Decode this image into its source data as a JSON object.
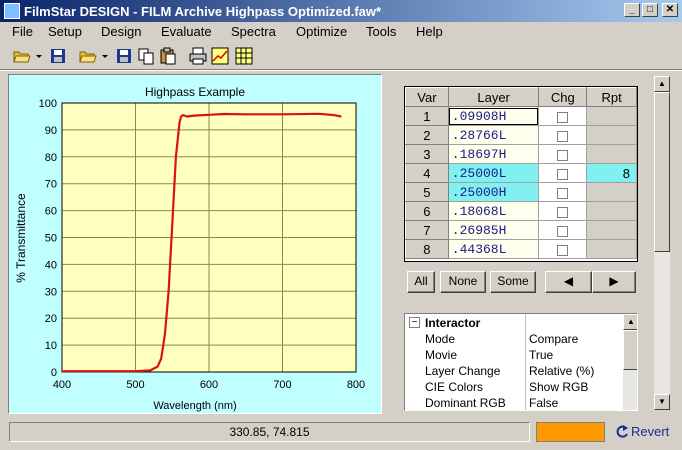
{
  "window": {
    "title": "FilmStar DESIGN - FILM Archive Highpass Optimized.faw*",
    "controls": [
      "_",
      "□",
      "✕"
    ]
  },
  "menu": [
    "File",
    "Setup",
    "Design",
    "Evaluate",
    "Spectra",
    "Optimize",
    "Tools",
    "Help"
  ],
  "toolbar": [
    "open-icon",
    "save-icon",
    "open-icon",
    "save-icon",
    "copy-icon",
    "paste-icon",
    "print-icon",
    "chart-icon",
    "table-icon"
  ],
  "chart_data": {
    "type": "line",
    "title": "Highpass Example",
    "xlabel": "Wavelength (nm)",
    "ylabel": "% Transmittance",
    "xlim": [
      400,
      800
    ],
    "ylim": [
      0,
      100
    ],
    "xticks": [
      "400",
      "500",
      "600",
      "700",
      "800"
    ],
    "yticks": [
      "0",
      "10",
      "20",
      "30",
      "40",
      "50",
      "60",
      "70",
      "80",
      "90",
      "100"
    ],
    "grid": true,
    "series": [
      {
        "color": "#dd1111",
        "x": [
          400,
          500,
          520,
          530,
          535,
          540,
          545,
          550,
          555,
          560,
          562,
          565,
          570,
          580,
          600,
          620,
          650,
          700,
          750,
          770,
          780
        ],
        "y": [
          0.3,
          0.3,
          0.6,
          2,
          5,
          14,
          30,
          55,
          80,
          93,
          95,
          95.5,
          95,
          95.3,
          95.6,
          95.9,
          95.8,
          95.8,
          96,
          95.5,
          95
        ]
      }
    ]
  },
  "grid": {
    "headers": [
      "Var",
      "Layer",
      "Chg",
      "Rpt"
    ],
    "rows": [
      {
        "var": "1",
        "layer": ".09908H",
        "rpt": ""
      },
      {
        "var": "2",
        "layer": ".28766L",
        "rpt": ""
      },
      {
        "var": "3",
        "layer": ".18697H",
        "rpt": ""
      },
      {
        "var": "4",
        "layer": ".25000L",
        "rpt": "8"
      },
      {
        "var": "5",
        "layer": ".25000H",
        "rpt": ""
      },
      {
        "var": "6",
        "layer": ".18068L",
        "rpt": ""
      },
      {
        "var": "7",
        "layer": ".26985H",
        "rpt": ""
      },
      {
        "var": "8",
        "layer": ".44368L",
        "rpt": ""
      }
    ]
  },
  "buttons": {
    "all": "All",
    "none": "None",
    "some": "Some",
    "prev": "◀",
    "next": "▶"
  },
  "properties": {
    "group": "Interactor",
    "items": [
      {
        "key": "Mode",
        "value": "Compare"
      },
      {
        "key": "Movie",
        "value": "True"
      },
      {
        "key": "Layer Change",
        "value": "Relative (%)"
      },
      {
        "key": "CIE Colors",
        "value": "Show RGB"
      },
      {
        "key": "Dominant RGB",
        "value": "False"
      }
    ]
  },
  "status": {
    "coords": "330.85, 74.815",
    "indicator_color": "#ff9900",
    "revert": "Revert"
  }
}
